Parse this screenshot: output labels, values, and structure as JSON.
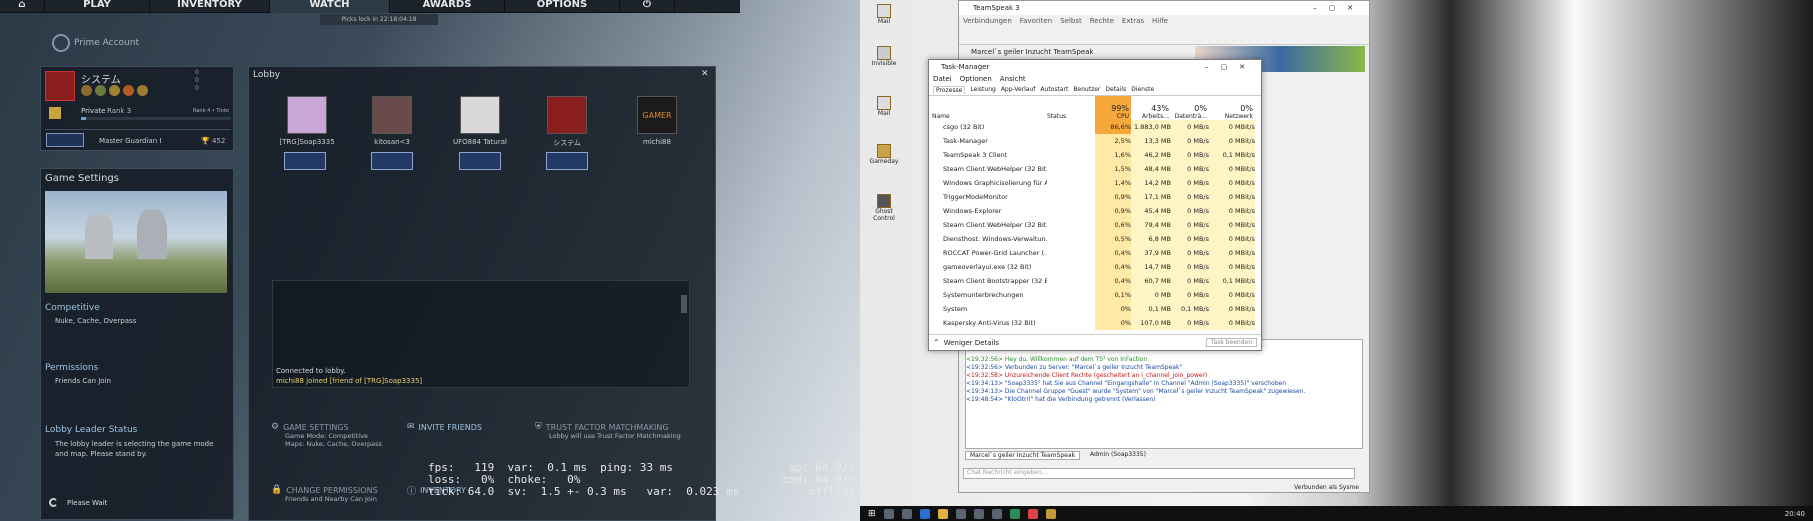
{
  "csgo": {
    "nav": [
      {
        "label": "⌂"
      },
      {
        "label": "PLAY"
      },
      {
        "label": "INVENTORY"
      },
      {
        "label": "WATCH"
      },
      {
        "label": "AWARDS"
      },
      {
        "label": "OPTIONS"
      },
      {
        "label": "⏻"
      }
    ],
    "pick_lock": "Picks lock in 22:18:04:18",
    "prime_label": "Prime Account",
    "profile": {
      "name": "システム",
      "rank_label": "Private",
      "rank_value": "Rank 3",
      "next_rank": "Rank 4 • Tinto",
      "skill": "Master Guardian I",
      "trophies": "452",
      "counts": [
        "0",
        "0",
        "0"
      ]
    },
    "game_settings": {
      "title": "Game Settings",
      "mode_heading": "Competitive",
      "maps": "Nuke, Cache, Overpass",
      "permissions_heading": "Permissions",
      "permissions_value": "Friends Can Join",
      "leader_heading": "Lobby Leader Status",
      "leader_text": "The lobby leader is selecting the game mode and map. Please stand by.",
      "wait": "Please Wait"
    },
    "lobby": {
      "title": "Lobby",
      "close": "✕",
      "members": [
        {
          "name": "[TRG]Soap3335"
        },
        {
          "name": "kitosan<3"
        },
        {
          "name": "UFO884 Tatural"
        },
        {
          "name": "システム"
        },
        {
          "name": "michi88"
        }
      ],
      "chat": [
        "Connected to lobby.",
        "michi88 joined [friend of [TRG]Soap3335]"
      ],
      "gs_heading": "GAME SETTINGS",
      "gs_mode": "Game Mode: Competitive",
      "gs_maps": "Maps: Nuke, Cache, Overpass",
      "invite": "INVITE FRIENDS",
      "tf_heading": "TRUST FACTOR MATCHMAKING",
      "tf_text": "Lobby will use Trust Factor Matchmaking",
      "perm_heading": "CHANGE PERMISSIONS",
      "perm_text": "Friends and Nearby Can Join",
      "inventory": "INVENTORY"
    },
    "netgraph": {
      "line1": "fps:   119  var:  0.1 ms  ping: 33 ms",
      "line2": "loss:   0%  choke:   0%",
      "line3": "tick: 64.0  sv:  1.5 +- 0.3 ms   var:  0.023 ms",
      "right1": "up: 64.0/s",
      "right2": "cmd: 64.0/s",
      "right3": "offline"
    }
  },
  "desktop": {
    "icons": [
      "Mail",
      "Invisible",
      "Mail",
      "Gameday",
      "Ghost Control"
    ],
    "clock": "20:40"
  },
  "teamspeak": {
    "title": "TeamSpeak 3",
    "menu": [
      "Verbindungen",
      "Favoriten",
      "Selbst",
      "Rechte",
      "Extras",
      "Hilfe"
    ],
    "server": "Marcel`s geiler Inzucht TeamSpeak",
    "tabs": [
      "Marcel`s geiler Inzucht TeamSpeak",
      "Admin (Soap3335)"
    ],
    "input_placeholder": "Chat Nachricht eingeben...",
    "status": "Verbunden als Sysme",
    "log": [
      "<19:32:56> Hey du, Willkommen auf dem TS³ von InFaction",
      "<19:32:56> Verbunden zu Server: \"Marcel`s geiler Inzucht TeamSpeak\"",
      "<19:32:58> Unzureichende Client Rechte (gescheitert an i_channel_join_power)",
      "<19:34:13> \"Soap3335\" hat Sie aus Channel \"Eingangshalle\" in Channel \"Admin (Soap3335)\" verschoben",
      "<19:34:13> Die Channel Gruppe \"Guest\" wurde \"System\" von \"Marcel`s geiler Inzucht TeamSpeak\" zugewiesen.",
      "<19:48:54> \"KloOtrrl\" hat die Verbindung getrennt (Verlassen)"
    ]
  },
  "taskmgr": {
    "title": "Task-Manager",
    "menu": [
      "Datei",
      "Optionen",
      "Ansicht"
    ],
    "tabs": [
      "Prozesse",
      "Leistung",
      "App-Verlauf",
      "Autostart",
      "Benutzer",
      "Details",
      "Dienste"
    ],
    "col_name": "Name",
    "col_status": "Status",
    "cpu_total": "99%",
    "cpu_label": "CPU",
    "mem_total": "43%",
    "mem_label": "Arbeits...",
    "disk_total": "0%",
    "disk_label": "Datenträ...",
    "net_total": "0%",
    "net_label": "Netzwerk",
    "rows": [
      {
        "name": "csgo (32 Bit)",
        "cpu": "86,6%",
        "mem": "1.883,0 MB",
        "disk": "0 MB/s",
        "net": "0 MBit/s"
      },
      {
        "name": "Task-Manager",
        "cpu": "2,5%",
        "mem": "13,3 MB",
        "disk": "0 MB/s",
        "net": "0 MBit/s"
      },
      {
        "name": "TeamSpeak 3 Client",
        "cpu": "1,6%",
        "mem": "46,2 MB",
        "disk": "0 MB/s",
        "net": "0,1 MBit/s"
      },
      {
        "name": "Steam Client WebHelper (32 Bit)",
        "cpu": "1,5%",
        "mem": "48,4 MB",
        "disk": "0 MB/s",
        "net": "0 MBit/s"
      },
      {
        "name": "Windows Graphicisolierung für A...",
        "cpu": "1,4%",
        "mem": "14,2 MB",
        "disk": "0 MB/s",
        "net": "0 MBit/s"
      },
      {
        "name": "TriggerModeMonitor",
        "cpu": "0,9%",
        "mem": "17,1 MB",
        "disk": "0 MB/s",
        "net": "0 MBit/s"
      },
      {
        "name": "Windows-Explorer",
        "cpu": "0,9%",
        "mem": "45,4 MB",
        "disk": "0 MB/s",
        "net": "0 MBit/s"
      },
      {
        "name": "Steam Client WebHelper (32 Bit)",
        "cpu": "0,6%",
        "mem": "79,4 MB",
        "disk": "0 MB/s",
        "net": "0 MBit/s"
      },
      {
        "name": "Diensthost: Windows-Verwaltun...",
        "cpu": "0,5%",
        "mem": "6,8 MB",
        "disk": "0 MB/s",
        "net": "0 MBit/s"
      },
      {
        "name": "ROCCAT Power-Grid Launcher (...",
        "cpu": "0,4%",
        "mem": "37,9 MB",
        "disk": "0 MB/s",
        "net": "0 MBit/s"
      },
      {
        "name": "gameoverlayui.exe (32 Bit)",
        "cpu": "0,4%",
        "mem": "14,7 MB",
        "disk": "0 MB/s",
        "net": "0 MBit/s"
      },
      {
        "name": "Steam Client Bootstrapper (32 Bit)",
        "cpu": "0,4%",
        "mem": "60,7 MB",
        "disk": "0 MB/s",
        "net": "0,1 MBit/s"
      },
      {
        "name": "Systemunterbrechungen",
        "cpu": "0,1%",
        "mem": "0 MB",
        "disk": "0 MB/s",
        "net": "0 MBit/s"
      },
      {
        "name": "System",
        "cpu": "0%",
        "mem": "0,1 MB",
        "disk": "0,1 MB/s",
        "net": "0 MBit/s"
      },
      {
        "name": "Kaspersky Anti-Virus (32 Bit)",
        "cpu": "0%",
        "mem": "107,0 MB",
        "disk": "0 MB/s",
        "net": "0 MBit/s"
      }
    ],
    "less": "Weniger Details",
    "end": "Task beenden"
  },
  "colors": {
    "cpu_hot": "#f7a83b",
    "cpu": "#ffe9a6",
    "lobby_panel": "#161e27",
    "accent": "#9fc3e0"
  }
}
